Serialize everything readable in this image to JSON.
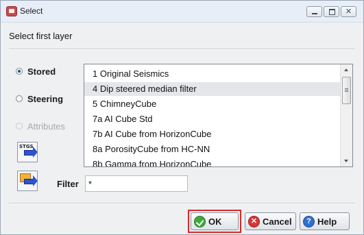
{
  "window": {
    "title": "Select"
  },
  "prompt": "Select first layer",
  "source_options": [
    {
      "label": "Stored",
      "checked": true,
      "enabled": true
    },
    {
      "label": "Steering",
      "checked": false,
      "enabled": true
    },
    {
      "label": "Attributes",
      "checked": false,
      "enabled": false
    }
  ],
  "layers": [
    {
      "label": "1 Original Seismics",
      "selected": false
    },
    {
      "label": "4 Dip steered median filter",
      "selected": true
    },
    {
      "label": "5 ChimneyCube",
      "selected": false
    },
    {
      "label": "7a AI Cube Std",
      "selected": false
    },
    {
      "label": "7b AI Cube from HorizonCube",
      "selected": false
    },
    {
      "label": "8a PorosityCube from HC-NN",
      "selected": false
    },
    {
      "label": "8b Gamma from HorizonCube",
      "selected": false
    }
  ],
  "steering_icon_text": "STGS",
  "filter": {
    "label": "Filter",
    "value": "*"
  },
  "buttons": {
    "ok": "OK",
    "cancel": "Cancel",
    "help": "Help"
  },
  "colors": {
    "highlight": "#d42a2a",
    "selection": "#e4e6ea"
  }
}
